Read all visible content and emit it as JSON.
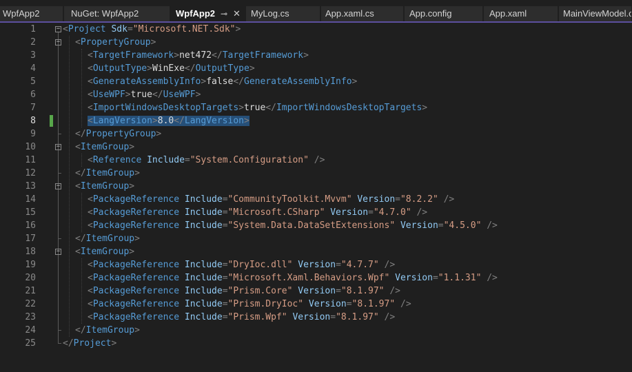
{
  "tabs": [
    {
      "label": "WpfApp2",
      "active": false
    },
    {
      "label": "NuGet: WpfApp2",
      "active": false
    },
    {
      "label": "WpfApp2",
      "active": true
    },
    {
      "label": "MyLog.cs",
      "active": false
    },
    {
      "label": "App.xaml.cs",
      "active": false
    },
    {
      "label": "App.config",
      "active": false
    },
    {
      "label": "App.xaml",
      "active": false
    },
    {
      "label": "MainViewModel.cs",
      "active": false
    }
  ],
  "tab_icons": {
    "pin": "pin-icon",
    "close": "close-icon"
  },
  "editor": {
    "current_line": 8,
    "lines": [
      {
        "n": "1",
        "indent": 0,
        "parts": [
          [
            "punc",
            "<"
          ],
          [
            "tag",
            "Project"
          ],
          [
            "txt",
            " "
          ],
          [
            "attr",
            "Sdk"
          ],
          [
            "punc",
            "="
          ],
          [
            "val",
            "\"Microsoft.NET.Sdk\""
          ],
          [
            "punc",
            ">"
          ]
        ]
      },
      {
        "n": "2",
        "indent": 1,
        "parts": [
          [
            "punc",
            "<"
          ],
          [
            "tag",
            "PropertyGroup"
          ],
          [
            "punc",
            ">"
          ]
        ]
      },
      {
        "n": "3",
        "indent": 2,
        "parts": [
          [
            "punc",
            "<"
          ],
          [
            "tag",
            "TargetFramework"
          ],
          [
            "punc",
            ">"
          ],
          [
            "txt",
            "net472"
          ],
          [
            "punc",
            "</"
          ],
          [
            "tag",
            "TargetFramework"
          ],
          [
            "punc",
            ">"
          ]
        ]
      },
      {
        "n": "4",
        "indent": 2,
        "parts": [
          [
            "punc",
            "<"
          ],
          [
            "tag",
            "OutputType"
          ],
          [
            "punc",
            ">"
          ],
          [
            "txt",
            "WinExe"
          ],
          [
            "punc",
            "</"
          ],
          [
            "tag",
            "OutputType"
          ],
          [
            "punc",
            ">"
          ]
        ]
      },
      {
        "n": "5",
        "indent": 2,
        "parts": [
          [
            "punc",
            "<"
          ],
          [
            "tag",
            "GenerateAssemblyInfo"
          ],
          [
            "punc",
            ">"
          ],
          [
            "txt",
            "false"
          ],
          [
            "punc",
            "</"
          ],
          [
            "tag",
            "GenerateAssemblyInfo"
          ],
          [
            "punc",
            ">"
          ]
        ]
      },
      {
        "n": "6",
        "indent": 2,
        "parts": [
          [
            "punc",
            "<"
          ],
          [
            "tag",
            "UseWPF"
          ],
          [
            "punc",
            ">"
          ],
          [
            "txt",
            "true"
          ],
          [
            "punc",
            "</"
          ],
          [
            "tag",
            "UseWPF"
          ],
          [
            "punc",
            ">"
          ]
        ]
      },
      {
        "n": "7",
        "indent": 2,
        "parts": [
          [
            "punc",
            "<"
          ],
          [
            "tag",
            "ImportWindowsDesktopTargets"
          ],
          [
            "punc",
            ">"
          ],
          [
            "txt",
            "true"
          ],
          [
            "punc",
            "</"
          ],
          [
            "tag",
            "ImportWindowsDesktopTargets"
          ],
          [
            "punc",
            ">"
          ]
        ]
      },
      {
        "n": "8",
        "indent": 2,
        "selected": true,
        "parts": [
          [
            "punc",
            "<"
          ],
          [
            "tag",
            "LangVersion"
          ],
          [
            "punc",
            ">"
          ],
          [
            "txt",
            "8.0"
          ],
          [
            "punc",
            "</"
          ],
          [
            "tag",
            "LangVersion"
          ],
          [
            "punc",
            ">"
          ]
        ]
      },
      {
        "n": "9",
        "indent": 1,
        "parts": [
          [
            "punc",
            "</"
          ],
          [
            "tag",
            "PropertyGroup"
          ],
          [
            "punc",
            ">"
          ]
        ]
      },
      {
        "n": "10",
        "indent": 1,
        "parts": [
          [
            "punc",
            "<"
          ],
          [
            "tag",
            "ItemGroup"
          ],
          [
            "punc",
            ">"
          ]
        ]
      },
      {
        "n": "11",
        "indent": 2,
        "parts": [
          [
            "punc",
            "<"
          ],
          [
            "tag",
            "Reference"
          ],
          [
            "txt",
            " "
          ],
          [
            "attr",
            "Include"
          ],
          [
            "punc",
            "="
          ],
          [
            "val",
            "\"System.Configuration\""
          ],
          [
            "txt",
            " "
          ],
          [
            "punc",
            "/>"
          ]
        ]
      },
      {
        "n": "12",
        "indent": 1,
        "parts": [
          [
            "punc",
            "</"
          ],
          [
            "tag",
            "ItemGroup"
          ],
          [
            "punc",
            ">"
          ]
        ]
      },
      {
        "n": "13",
        "indent": 1,
        "parts": [
          [
            "punc",
            "<"
          ],
          [
            "tag",
            "ItemGroup"
          ],
          [
            "punc",
            ">"
          ]
        ]
      },
      {
        "n": "14",
        "indent": 2,
        "parts": [
          [
            "punc",
            "<"
          ],
          [
            "tag",
            "PackageReference"
          ],
          [
            "txt",
            " "
          ],
          [
            "attr",
            "Include"
          ],
          [
            "punc",
            "="
          ],
          [
            "val",
            "\"CommunityToolkit.Mvvm\""
          ],
          [
            "txt",
            " "
          ],
          [
            "attr",
            "Version"
          ],
          [
            "punc",
            "="
          ],
          [
            "val",
            "\"8.2.2\""
          ],
          [
            "txt",
            " "
          ],
          [
            "punc",
            "/>"
          ]
        ]
      },
      {
        "n": "15",
        "indent": 2,
        "parts": [
          [
            "punc",
            "<"
          ],
          [
            "tag",
            "PackageReference"
          ],
          [
            "txt",
            " "
          ],
          [
            "attr",
            "Include"
          ],
          [
            "punc",
            "="
          ],
          [
            "val",
            "\"Microsoft.CSharp\""
          ],
          [
            "txt",
            " "
          ],
          [
            "attr",
            "Version"
          ],
          [
            "punc",
            "="
          ],
          [
            "val",
            "\"4.7.0\""
          ],
          [
            "txt",
            " "
          ],
          [
            "punc",
            "/>"
          ]
        ]
      },
      {
        "n": "16",
        "indent": 2,
        "parts": [
          [
            "punc",
            "<"
          ],
          [
            "tag",
            "PackageReference"
          ],
          [
            "txt",
            " "
          ],
          [
            "attr",
            "Include"
          ],
          [
            "punc",
            "="
          ],
          [
            "val",
            "\"System.Data.DataSetExtensions\""
          ],
          [
            "txt",
            " "
          ],
          [
            "attr",
            "Version"
          ],
          [
            "punc",
            "="
          ],
          [
            "val",
            "\"4.5.0\""
          ],
          [
            "txt",
            " "
          ],
          [
            "punc",
            "/>"
          ]
        ]
      },
      {
        "n": "17",
        "indent": 1,
        "parts": [
          [
            "punc",
            "</"
          ],
          [
            "tag",
            "ItemGroup"
          ],
          [
            "punc",
            ">"
          ]
        ]
      },
      {
        "n": "18",
        "indent": 1,
        "parts": [
          [
            "punc",
            "<"
          ],
          [
            "tag",
            "ItemGroup"
          ],
          [
            "punc",
            ">"
          ]
        ]
      },
      {
        "n": "19",
        "indent": 2,
        "parts": [
          [
            "punc",
            "<"
          ],
          [
            "tag",
            "PackageReference"
          ],
          [
            "txt",
            " "
          ],
          [
            "attr",
            "Include"
          ],
          [
            "punc",
            "="
          ],
          [
            "val",
            "\"DryIoc.dll\""
          ],
          [
            "txt",
            " "
          ],
          [
            "attr",
            "Version"
          ],
          [
            "punc",
            "="
          ],
          [
            "val",
            "\"4.7.7\""
          ],
          [
            "txt",
            " "
          ],
          [
            "punc",
            "/>"
          ]
        ]
      },
      {
        "n": "20",
        "indent": 2,
        "parts": [
          [
            "punc",
            "<"
          ],
          [
            "tag",
            "PackageReference"
          ],
          [
            "txt",
            " "
          ],
          [
            "attr",
            "Include"
          ],
          [
            "punc",
            "="
          ],
          [
            "val",
            "\"Microsoft.Xaml.Behaviors.Wpf\""
          ],
          [
            "txt",
            " "
          ],
          [
            "attr",
            "Version"
          ],
          [
            "punc",
            "="
          ],
          [
            "val",
            "\"1.1.31\""
          ],
          [
            "txt",
            " "
          ],
          [
            "punc",
            "/>"
          ]
        ]
      },
      {
        "n": "21",
        "indent": 2,
        "parts": [
          [
            "punc",
            "<"
          ],
          [
            "tag",
            "PackageReference"
          ],
          [
            "txt",
            " "
          ],
          [
            "attr",
            "Include"
          ],
          [
            "punc",
            "="
          ],
          [
            "val",
            "\"Prism.Core\""
          ],
          [
            "txt",
            " "
          ],
          [
            "attr",
            "Version"
          ],
          [
            "punc",
            "="
          ],
          [
            "val",
            "\"8.1.97\""
          ],
          [
            "txt",
            " "
          ],
          [
            "punc",
            "/>"
          ]
        ]
      },
      {
        "n": "22",
        "indent": 2,
        "parts": [
          [
            "punc",
            "<"
          ],
          [
            "tag",
            "PackageReference"
          ],
          [
            "txt",
            " "
          ],
          [
            "attr",
            "Include"
          ],
          [
            "punc",
            "="
          ],
          [
            "val",
            "\"Prism.DryIoc\""
          ],
          [
            "txt",
            " "
          ],
          [
            "attr",
            "Version"
          ],
          [
            "punc",
            "="
          ],
          [
            "val",
            "\"8.1.97\""
          ],
          [
            "txt",
            " "
          ],
          [
            "punc",
            "/>"
          ]
        ]
      },
      {
        "n": "23",
        "indent": 2,
        "parts": [
          [
            "punc",
            "<"
          ],
          [
            "tag",
            "PackageReference"
          ],
          [
            "txt",
            " "
          ],
          [
            "attr",
            "Include"
          ],
          [
            "punc",
            "="
          ],
          [
            "val",
            "\"Prism.Wpf\""
          ],
          [
            "txt",
            " "
          ],
          [
            "attr",
            "Version"
          ],
          [
            "punc",
            "="
          ],
          [
            "val",
            "\"8.1.97\""
          ],
          [
            "txt",
            " "
          ],
          [
            "punc",
            "/>"
          ]
        ]
      },
      {
        "n": "24",
        "indent": 1,
        "parts": [
          [
            "punc",
            "</"
          ],
          [
            "tag",
            "ItemGroup"
          ],
          [
            "punc",
            ">"
          ]
        ]
      },
      {
        "n": "25",
        "indent": 0,
        "parts": [
          [
            "punc",
            "</"
          ],
          [
            "tag",
            "Project"
          ],
          [
            "punc",
            ">"
          ]
        ]
      }
    ]
  }
}
